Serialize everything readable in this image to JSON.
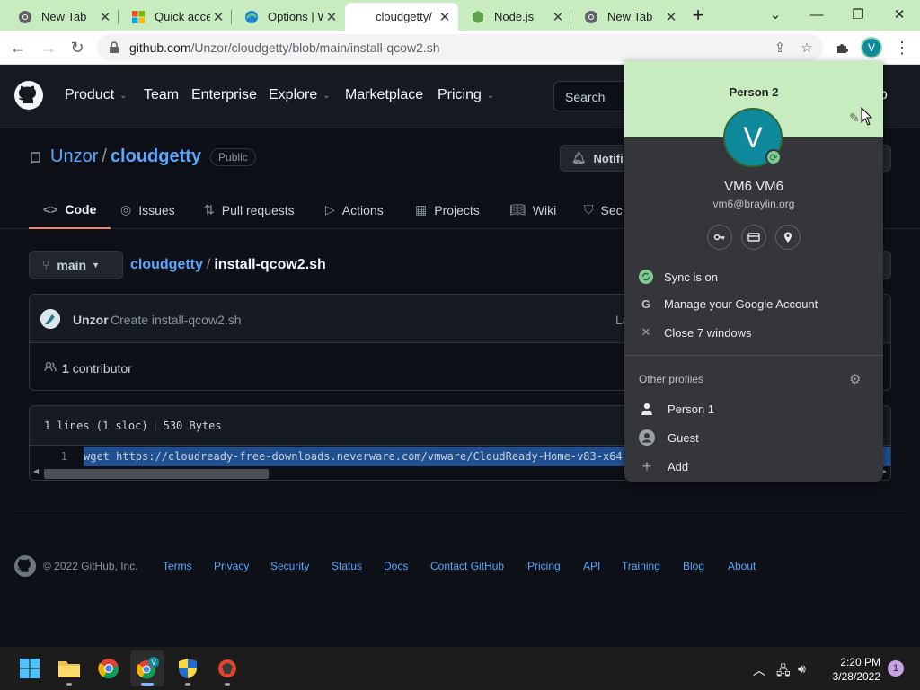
{
  "browser": {
    "tabs": [
      {
        "title": "New Tab",
        "icon": "chrome-icon"
      },
      {
        "title": "Quick acces",
        "icon": "windows-icon"
      },
      {
        "title": "Options | W",
        "icon": "edge-icon"
      },
      {
        "title": "cloudgetty/",
        "icon": "github-icon"
      },
      {
        "title": "Node.js",
        "icon": "nodejs-icon"
      },
      {
        "title": "New Tab",
        "icon": "chrome-icon"
      }
    ],
    "url_host": "github.com",
    "url_path": "/Unzor/cloudgetty/blob/main/install-qcow2.sh",
    "profile_initial": "V",
    "colors": {
      "frame": "#c8ecbf",
      "avatar": "#0f8a9c"
    }
  },
  "gh": {
    "nav": [
      "Product",
      "Team",
      "Enterprise",
      "Explore",
      "Marketplace",
      "Pricing"
    ],
    "search_placeholder": "Search",
    "signup": "up"
  },
  "repo": {
    "owner": "Unzor",
    "slash": "/",
    "name": "cloudgetty",
    "visibility": "Public",
    "notify": "Notific",
    "tabs": [
      "Code",
      "Issues",
      "Pull requests",
      "Actions",
      "Projects",
      "Wiki",
      "Sec"
    ],
    "branch": "main",
    "crumb_repo": "cloudgetty",
    "crumb_sep": "/",
    "crumb_file": "install-qcow2.sh",
    "commit_author": "Unzor",
    "commit_message": "Create install-qcow2.sh",
    "commit_latest": "La",
    "contributors_count": "1",
    "contributors_label": "contributor",
    "file_lines": "1 lines (1 sloc)",
    "file_size": "530 Bytes",
    "line_number": "1",
    "code_text": "wget https://cloudready-free-downloads.neverware.com/vmware/CloudReady-Home-v83-x64.ova",
    "code_op": "&&"
  },
  "footer": {
    "copyright": "© 2022 GitHub, Inc.",
    "links": [
      "Terms",
      "Privacy",
      "Security",
      "Status",
      "Docs",
      "Contact GitHub",
      "Pricing",
      "API",
      "Training",
      "Blog",
      "About"
    ]
  },
  "profile_menu": {
    "header_name": "Person 2",
    "avatar_initial": "V",
    "full_name": "VM6 VM6",
    "email": "vm6@braylin.org",
    "quick_icons": [
      "key-icon",
      "card-icon",
      "location-icon"
    ],
    "items": [
      {
        "label": "Sync is on",
        "icon": "sync-icon"
      },
      {
        "label": "Manage your Google Account",
        "icon": "google-icon"
      },
      {
        "label": "Close 7 windows",
        "icon": "close-icon"
      }
    ],
    "other_profiles_label": "Other profiles",
    "profiles": [
      {
        "label": "Person 1",
        "icon": "person-icon"
      },
      {
        "label": "Guest",
        "icon": "guest-icon"
      },
      {
        "label": "Add",
        "icon": "plus-icon"
      }
    ]
  },
  "taskbar": {
    "time": "2:20 PM",
    "date": "3/28/2022",
    "notification_count": "1"
  }
}
